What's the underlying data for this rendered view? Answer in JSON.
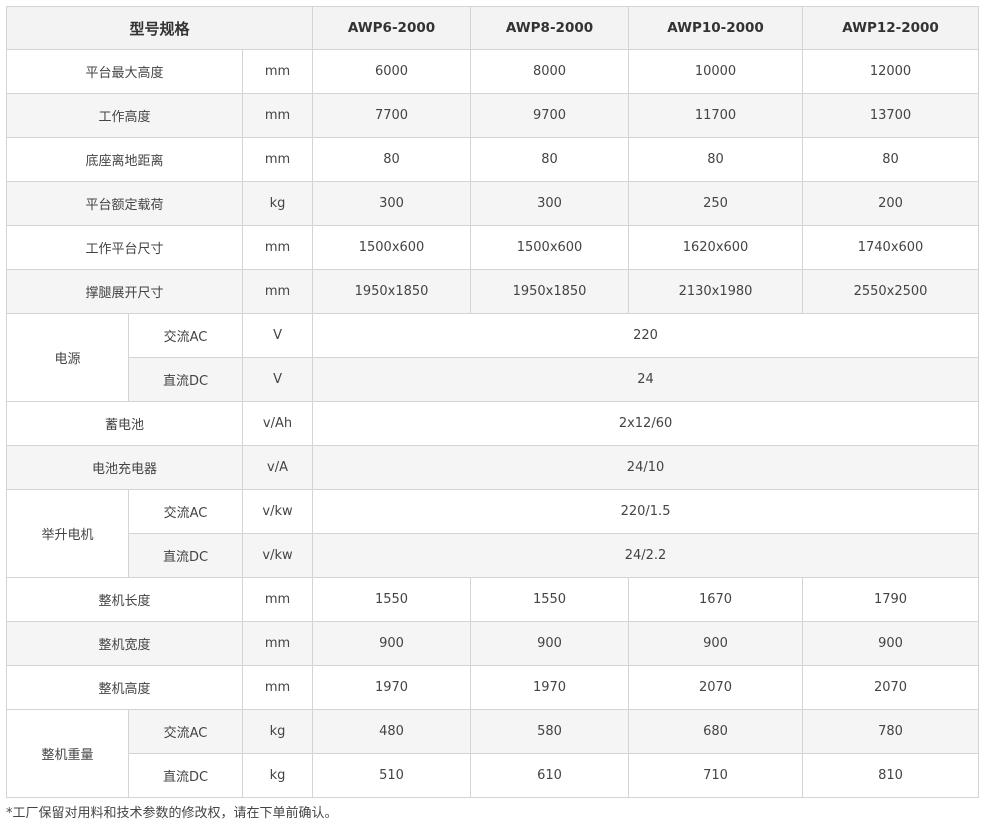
{
  "header": {
    "title": "型号规格",
    "models": [
      "AWP6-2000",
      "AWP8-2000",
      "AWP10-2000",
      "AWP12-2000"
    ]
  },
  "rows": [
    {
      "label": "平台最大高度",
      "unit": "mm",
      "values": [
        "6000",
        "8000",
        "10000",
        "12000"
      ]
    },
    {
      "label": "工作高度",
      "unit": "mm",
      "values": [
        "7700",
        "9700",
        "11700",
        "13700"
      ]
    },
    {
      "label": "底座离地距离",
      "unit": "mm",
      "values": [
        "80",
        "80",
        "80",
        "80"
      ]
    },
    {
      "label": "平台额定载荷",
      "unit": "kg",
      "values": [
        "300",
        "300",
        "250",
        "200"
      ]
    },
    {
      "label": "工作平台尺寸",
      "unit": "mm",
      "values": [
        "1500x600",
        "1500x600",
        "1620x600",
        "1740x600"
      ]
    },
    {
      "label": "撑腿展开尺寸",
      "unit": "mm",
      "values": [
        "1950x1850",
        "1950x1850",
        "2130x1980",
        "2550x2500"
      ]
    }
  ],
  "power": {
    "label": "电源",
    "ac": {
      "label": "交流AC",
      "unit": "V",
      "value": "220"
    },
    "dc": {
      "label": "直流DC",
      "unit": "V",
      "value": "24"
    }
  },
  "battery": {
    "label": "蓄电池",
    "unit": "v/Ah",
    "value": "2x12/60"
  },
  "charger": {
    "label": "电池充电器",
    "unit": "v/A",
    "value": "24/10"
  },
  "motor": {
    "label": "举升电机",
    "ac": {
      "label": "交流AC",
      "unit": "v/kw",
      "value": "220/1.5"
    },
    "dc": {
      "label": "直流DC",
      "unit": "v/kw",
      "value": "24/2.2"
    }
  },
  "dims": [
    {
      "label": "整机长度",
      "unit": "mm",
      "values": [
        "1550",
        "1550",
        "1670",
        "1790"
      ]
    },
    {
      "label": "整机宽度",
      "unit": "mm",
      "values": [
        "900",
        "900",
        "900",
        "900"
      ]
    },
    {
      "label": "整机高度",
      "unit": "mm",
      "values": [
        "1970",
        "1970",
        "2070",
        "2070"
      ]
    }
  ],
  "weight": {
    "label": "整机重量",
    "ac": {
      "label": "交流AC",
      "unit": "kg",
      "values": [
        "480",
        "580",
        "680",
        "780"
      ]
    },
    "dc": {
      "label": "直流DC",
      "unit": "kg",
      "values": [
        "510",
        "610",
        "710",
        "810"
      ]
    }
  },
  "footnote": "*工厂保留对用料和技术参数的修改权，请在下单前确认。"
}
